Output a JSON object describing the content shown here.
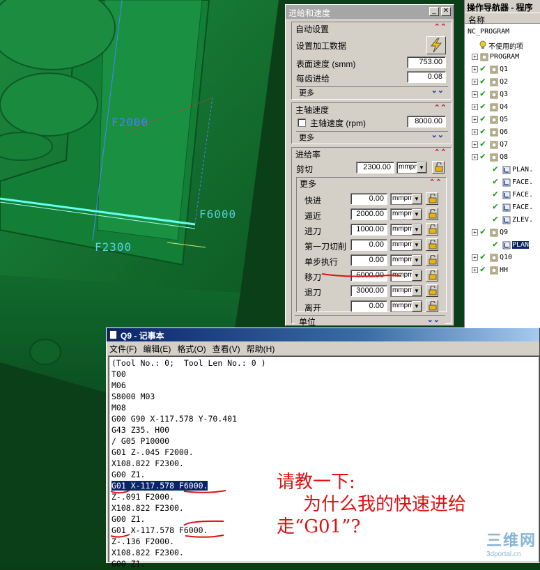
{
  "viewport": {
    "labels": [
      "F2000",
      "F6000",
      "F2300"
    ]
  },
  "feeds_dialog": {
    "title": "进给和速度",
    "auto_settings": {
      "header": "自动设置",
      "set_machining_data": "设置加工数据",
      "surface_speed_label": "表面速度 (smm)",
      "surface_speed_value": "753.00",
      "feed_per_tooth_label": "每齿进给",
      "feed_per_tooth_value": "0.08",
      "more_label": "更多"
    },
    "spindle": {
      "header": "主轴速度",
      "spindle_speed_label": "主轴速度 (rpm)",
      "spindle_speed_value": "8000.00",
      "more_label": "更多"
    },
    "feed_rates": {
      "header": "进给率",
      "cut_label": "剪切",
      "cut_value": "2300.00",
      "cut_unit": "mmpm",
      "more_label": "更多",
      "rows": [
        {
          "label": "快进",
          "value": "0.00",
          "unit": "mmpm"
        },
        {
          "label": "逼近",
          "value": "2000.00",
          "unit": "mmpm"
        },
        {
          "label": "进刀",
          "value": "1000.00",
          "unit": "mmpm"
        },
        {
          "label": "第一刀切削",
          "value": "0.00",
          "unit": "mmpm"
        },
        {
          "label": "单步执行",
          "value": "0.00",
          "unit": "mmpm"
        },
        {
          "label": "移刀",
          "value": "6000.00",
          "unit": "mmpm"
        },
        {
          "label": "退刀",
          "value": "3000.00",
          "unit": "mmpm"
        },
        {
          "label": "离开",
          "value": "0.00",
          "unit": "mmpm"
        }
      ]
    },
    "units_label": "单位"
  },
  "navigator": {
    "title": "操作导航器 - 程序",
    "column": "名称",
    "items": [
      {
        "label": "NC_PROGRAM"
      },
      {
        "label": "不使用的项"
      },
      {
        "label": "PROGRAM"
      },
      {
        "label": "Q1"
      },
      {
        "label": "Q2"
      },
      {
        "label": "Q3"
      },
      {
        "label": "Q4"
      },
      {
        "label": "Q5"
      },
      {
        "label": "Q6"
      },
      {
        "label": "Q7"
      },
      {
        "label": "Q8"
      },
      {
        "label": "PLAN."
      },
      {
        "label": "FACE."
      },
      {
        "label": "FACE."
      },
      {
        "label": "FACE."
      },
      {
        "label": "ZLEV."
      },
      {
        "label": "Q9"
      },
      {
        "label": "PLAN"
      },
      {
        "label": "Q10"
      },
      {
        "label": "HH"
      }
    ]
  },
  "notepad": {
    "title": "Q9 - 记事本",
    "menu": [
      "文件(F)",
      "编辑(E)",
      "格式(O)",
      "查看(V)",
      "帮助(H)"
    ],
    "lines": [
      "(Tool No.: 0;  Tool Len No.: 0 )",
      "T00",
      "M06",
      "S8000 M03",
      "M08",
      "G00 G90 X-117.578 Y-70.401",
      "G43 Z35. H00",
      "/ G05 P10000",
      "G01 Z-.045 F2000.",
      "X108.822 F2300.",
      "G00 Z1.",
      "G01 X-117.578 F6000.",
      "Z-.091 F2000.",
      "X108.822 F2300.",
      "G00 Z1.",
      "G01 X-117.578 F6000.",
      "Z-.136 F2000.",
      "X108.822 F2300.",
      "G00 Z1."
    ],
    "question_lines": [
      "请教一下:",
      "为什么我的快速进给",
      "走“G01”?"
    ]
  },
  "watermark": {
    "brand": "三维网",
    "url": "3dportal.cn"
  },
  "colors": {
    "model_green": "#0f6b2c",
    "annotation_red": "#dd1111",
    "select_blue": "#0a246a"
  }
}
